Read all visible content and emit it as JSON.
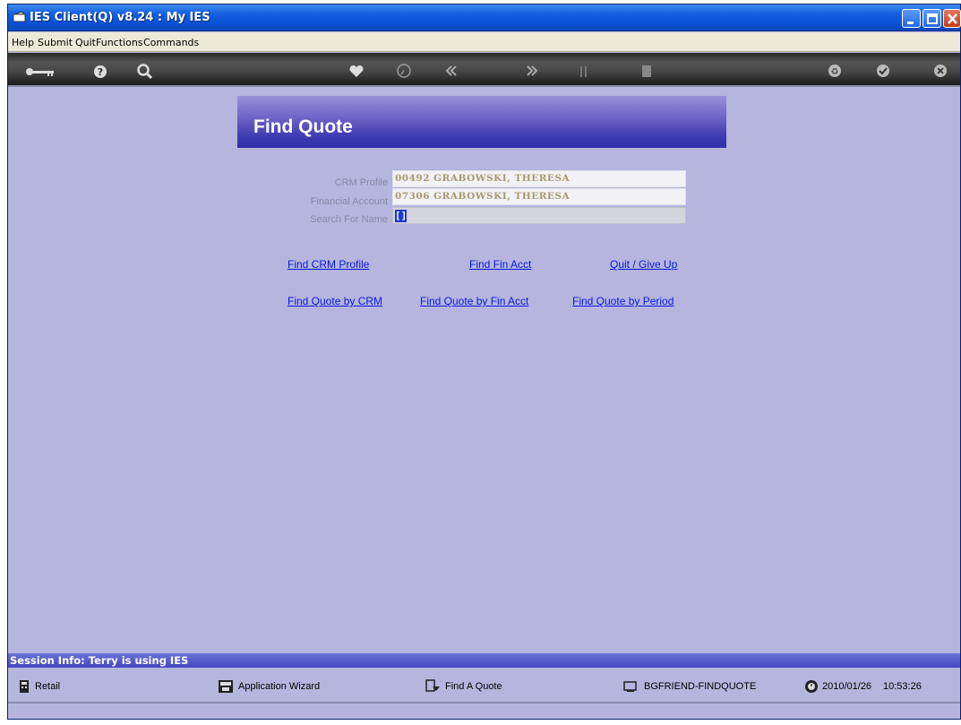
{
  "window": {
    "title": "IES Client(Q) v8.24 : My IES"
  },
  "menu": [
    "Help",
    "Submit",
    "Quit",
    "Functions",
    "Commands"
  ],
  "toolbar": {
    "icons": [
      "key-icon",
      "help-icon",
      "search-icon",
      "heart-icon",
      "clock-icon",
      "back-icon",
      "forward-icon",
      "sort-icon",
      "page-icon",
      "recycle-icon",
      "check-icon",
      "close-icon"
    ]
  },
  "form": {
    "heading": "Find Quote",
    "fields": [
      {
        "label": "CRM Profile",
        "value": "00492 GRABOWSKI, THERESA"
      },
      {
        "label": "Financial Account",
        "value": "07306 GRABOWSKI, THERESA"
      },
      {
        "label": "Search For Name",
        "value": "[]"
      }
    ]
  },
  "links": {
    "row1": [
      "Find CRM Profile",
      "Find Fin Acct",
      "Quit / Give Up"
    ],
    "row2": [
      "Find Quote by CRM",
      "Find Quote by Fin Acct",
      "Find Quote by Period"
    ]
  },
  "session": {
    "info": "Session Info: Terry is using IES"
  },
  "status": {
    "retail": "Retail",
    "wizard": "Application Wizard",
    "find_quote": "Find A Quote",
    "screen": "BGFRIEND-FINDQUOTE",
    "date": "2010/01/26",
    "time": "10:53:26"
  },
  "colors": {
    "background": "#b5b5de",
    "link": "#0a18e0",
    "title_bar": "#0a52d6"
  }
}
